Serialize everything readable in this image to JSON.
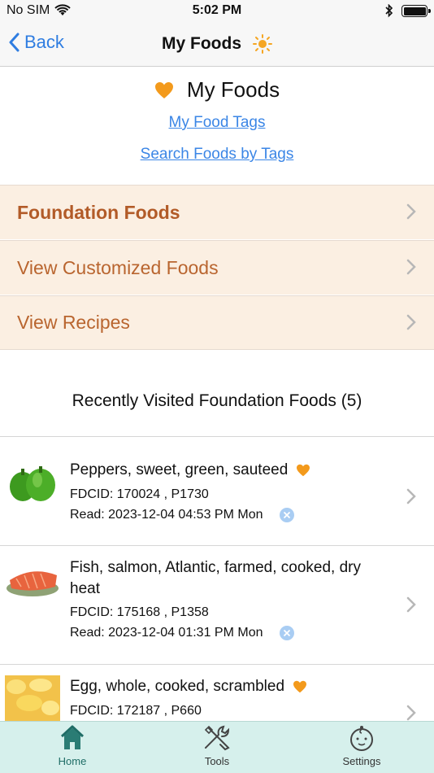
{
  "status_bar": {
    "carrier": "No SIM",
    "time": "5:02 PM"
  },
  "nav": {
    "back_label": "Back",
    "title": "My Foods"
  },
  "header": {
    "title": "My Foods",
    "link_tags": "My Food Tags",
    "link_search": "Search Foods by Tags"
  },
  "menu": [
    {
      "label": "Foundation Foods"
    },
    {
      "label": "View Customized Foods"
    },
    {
      "label": "View Recipes"
    }
  ],
  "recent": {
    "title": "Recently Visited Foundation Foods (5)",
    "items": [
      {
        "name": "Peppers, sweet, green, sauteed",
        "fdcid": "FDCID: 170024 , P1730",
        "read": "Read: 2023-12-04 04:53 PM Mon",
        "favorite": true,
        "image": "green-peppers"
      },
      {
        "name": "Fish, salmon, Atlantic, farmed, cooked, dry heat",
        "fdcid": "FDCID: 175168 , P1358",
        "read": "Read: 2023-12-04 01:31 PM Mon",
        "favorite": false,
        "image": "salmon-fillet"
      },
      {
        "name": "Egg, whole, cooked, scrambled",
        "fdcid": "FDCID: 172187 , P660",
        "read": "",
        "favorite": true,
        "image": "scrambled-eggs"
      }
    ]
  },
  "tabs": [
    {
      "label": "Home",
      "icon": "house-icon",
      "active": true
    },
    {
      "label": "Tools",
      "icon": "tools-icon",
      "active": false
    },
    {
      "label": "Settings",
      "icon": "baby-face-icon",
      "active": false
    }
  ],
  "colors": {
    "accent_blue": "#2f7de1",
    "heart_orange": "#f39a1c",
    "menu_bg": "#fbefe2",
    "menu_text": "#b9652f",
    "tabbar_bg": "#d6f0ec",
    "tab_active": "#1f6d66"
  }
}
